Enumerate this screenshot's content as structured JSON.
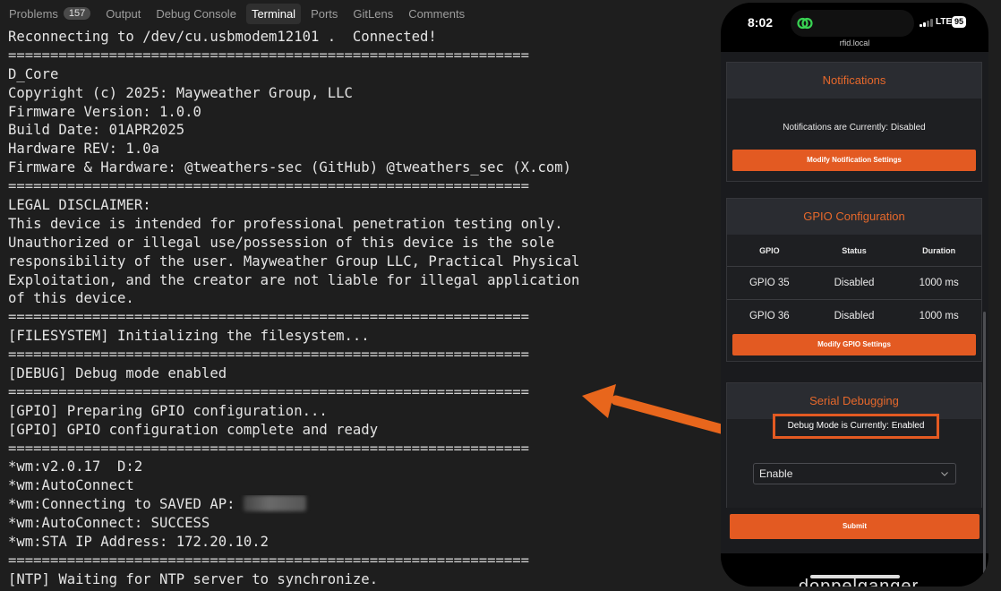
{
  "panel_tabs": [
    {
      "label": "Problems",
      "badge": "157",
      "active": false
    },
    {
      "label": "Output",
      "active": false
    },
    {
      "label": "Debug Console",
      "active": false
    },
    {
      "label": "Terminal",
      "active": true
    },
    {
      "label": "Ports",
      "active": false
    },
    {
      "label": "GitLens",
      "active": false
    },
    {
      "label": "Comments",
      "active": false
    }
  ],
  "terminal": {
    "lines": [
      "Reconnecting to /dev/cu.usbmodem12101 .  Connected!",
      "==============================================================",
      "D_Core",
      "Copyright (c) 2025: Mayweather Group, LLC",
      "Firmware Version: 1.0.0",
      "Build Date: 01APR2025",
      "Hardware REV: 1.0a",
      "Firmware & Hardware: @tweathers-sec (GitHub) @tweathers_sec (X.com)",
      "==============================================================",
      "LEGAL DISCLAIMER:",
      "This device is intended for professional penetration testing only.",
      "Unauthorized or illegal use/possession of this device is the sole",
      "responsibility of the user. Mayweather Group LLC, Practical Physical",
      "Exploitation, and the creator are not liable for illegal application",
      "of this device.",
      "==============================================================",
      "[FILESYSTEM] Initializing the filesystem...",
      "==============================================================",
      "[DEBUG] Debug mode enabled",
      "==============================================================",
      "[GPIO] Preparing GPIO configuration...",
      "[GPIO] GPIO configuration complete and ready",
      "==============================================================",
      "*wm:v2.0.17  D:2",
      "*wm:AutoConnect",
      "*wm:Connecting to SAVED AP:",
      "*wm:AutoConnect: SUCCESS",
      "*wm:STA IP Address: 172.20.10.2",
      "==============================================================",
      "[NTP] Waiting for NTP server to synchronize."
    ]
  },
  "phone": {
    "time": "8:02",
    "network": "LTE",
    "battery": "95",
    "url": "rfid.local",
    "notifications": {
      "title": "Notifications",
      "status": "Notifications are Currently: Disabled",
      "button": "Modify Notification Settings"
    },
    "gpio": {
      "title": "GPIO Configuration",
      "headers": [
        "GPIO",
        "Status",
        "Duration"
      ],
      "rows": [
        [
          "GPIO 35",
          "Disabled",
          "1000 ms"
        ],
        [
          "GPIO 36",
          "Disabled",
          "1000 ms"
        ]
      ],
      "button": "Modify GPIO Settings"
    },
    "serial": {
      "title": "Serial Debugging",
      "status": "Debug Mode is Currently: Enabled",
      "select_value": "Enable",
      "submit": "Submit"
    },
    "watermark": "doppelganger"
  },
  "colors": {
    "accent_orange": "#e35a22",
    "header_orange_text": "#e6682b",
    "terminal_bg": "#1e1e1e",
    "arrow": "#e8661c"
  }
}
